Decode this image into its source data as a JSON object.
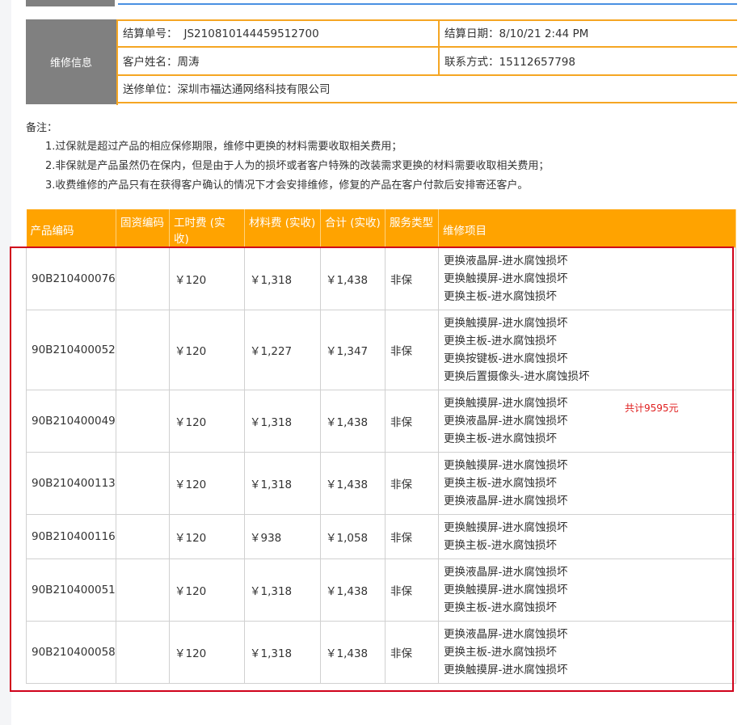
{
  "info": {
    "label": "维修信息",
    "settlement_no_label": "结算单号：",
    "settlement_no": "JS210810144459512700",
    "settlement_date_label": "结算日期：",
    "settlement_date": "8/10/21 2:44 PM",
    "customer_label": "客户姓名：",
    "customer": "周涛",
    "contact_label": "联系方式：",
    "contact": "15112657798",
    "unit_label": "送修单位：",
    "unit": "深圳市福达通网络科技有限公司"
  },
  "notes": {
    "head": "备注：",
    "lines": [
      "1.过保就是超过产品的相应保修期限，维修中更换的材料需要收取相关费用；",
      "2.非保就是产品虽然仍在保内，但是由于人为的损坏或者客户特殊的改装需求更换的材料需要收取相关费用；",
      "3.收费维修的产品只有在获得客户确认的情况下才会安排维修，修复的产品在客户付款后安排寄还客户。"
    ]
  },
  "table": {
    "headers": [
      "产品编码",
      "固资编码",
      "工时费 (实收)",
      "材料费 (实收)",
      "合计 (实收)",
      "服务类型",
      "维修项目"
    ],
    "rows": [
      {
        "code": "90B210400076",
        "asset": "",
        "labor": "￥120",
        "material": "￥1,318",
        "total": "￥1,438",
        "type": "非保",
        "items": [
          "更换液晶屏-进水腐蚀损坏",
          "更换触摸屏-进水腐蚀损坏",
          "更换主板-进水腐蚀损坏"
        ]
      },
      {
        "code": "90B210400052",
        "asset": "",
        "labor": "￥120",
        "material": "￥1,227",
        "total": "￥1,347",
        "type": "非保",
        "items": [
          "更换触摸屏-进水腐蚀损坏",
          "更换主板-进水腐蚀损坏",
          "更换按键板-进水腐蚀损坏",
          "更换后置摄像头-进水腐蚀损坏"
        ]
      },
      {
        "code": "90B210400049",
        "asset": "",
        "labor": "￥120",
        "material": "￥1,318",
        "total": "￥1,438",
        "type": "非保",
        "items": [
          "更换触摸屏-进水腐蚀损坏",
          "更换液晶屏-进水腐蚀损坏",
          "更换主板-进水腐蚀损坏"
        ]
      },
      {
        "code": "90B210400113",
        "asset": "",
        "labor": "￥120",
        "material": "￥1,318",
        "total": "￥1,438",
        "type": "非保",
        "items": [
          "更换触摸屏-进水腐蚀损坏",
          "更换主板-进水腐蚀损坏",
          "更换液晶屏-进水腐蚀损坏"
        ]
      },
      {
        "code": "90B210400116",
        "asset": "",
        "labor": "￥120",
        "material": "￥938",
        "total": "￥1,058",
        "type": "非保",
        "items": [
          "更换触摸屏-进水腐蚀损坏",
          "更换主板-进水腐蚀损坏"
        ]
      },
      {
        "code": "90B210400051",
        "asset": "",
        "labor": "￥120",
        "material": "￥1,318",
        "total": "￥1,438",
        "type": "非保",
        "items": [
          "更换液晶屏-进水腐蚀损坏",
          "更换触摸屏-进水腐蚀损坏",
          "更换主板-进水腐蚀损坏"
        ]
      },
      {
        "code": "90B210400058",
        "asset": "",
        "labor": "￥120",
        "material": "￥1,318",
        "total": "￥1,438",
        "type": "非保",
        "items": [
          "更换液晶屏-进水腐蚀损坏",
          "更换主板-进水腐蚀损坏",
          "更换触摸屏-进水腐蚀损坏"
        ]
      }
    ]
  },
  "annotation": {
    "total_text": "共计9595元",
    "color": "#e02020",
    "box_color": "#d0021b"
  },
  "colors": {
    "header_bg": "#ffa300",
    "label_bg": "#808080",
    "border_accent": "#f5a623",
    "top_line": "#4a90e2"
  }
}
